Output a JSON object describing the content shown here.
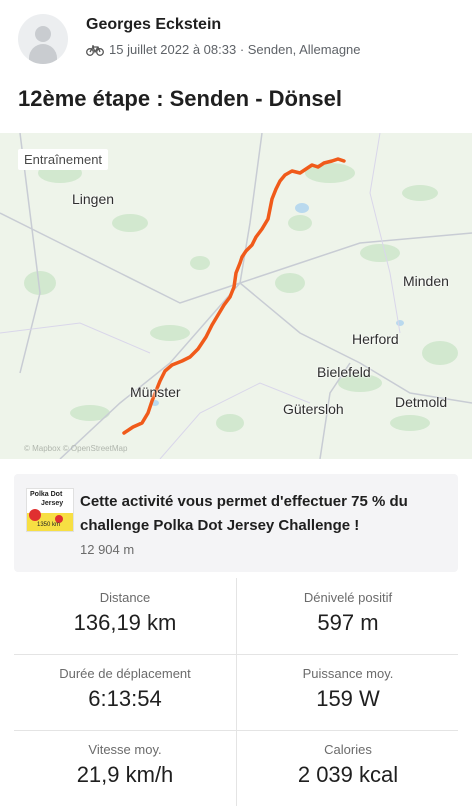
{
  "activity": {
    "user_name": "Georges Eckstein",
    "meta": "15 juillet 2022 à 08:33 · Senden, Allemagne",
    "activity_icon": "bike-icon",
    "title": "12ème étape : Senden - Dönsel"
  },
  "map": {
    "badge": "Entraînement",
    "route_color": "#f05a1a",
    "places": [
      "Lingen",
      "Minden",
      "Herford",
      "Bielefeld",
      "Münster",
      "Detmold",
      "Gütersloh"
    ],
    "attribution": "© Mapbox © OpenStreetMap"
  },
  "challenge": {
    "badge_line1": "Polka Dot",
    "badge_line2": "Jersey",
    "badge_distance": "1350 km",
    "text": "Cette activité vous permet d'effectuer 75 % du challenge Polka Dot Jersey Challenge !",
    "distance": "12 904 m"
  },
  "stats": [
    {
      "label": "Distance",
      "value": "136,19 km"
    },
    {
      "label": "Dénivelé positif",
      "value": "597 m"
    },
    {
      "label": "Durée de déplacement",
      "value": "6:13:54"
    },
    {
      "label": "Puissance moy.",
      "value": "159 W"
    },
    {
      "label": "Vitesse moy.",
      "value": "21,9 km/h"
    },
    {
      "label": "Calories",
      "value": "2 039 kcal"
    }
  ]
}
